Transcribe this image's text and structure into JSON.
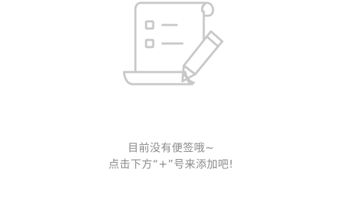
{
  "empty_state": {
    "icon": "notes-pencil-icon",
    "line1": "目前没有便签哦~",
    "line2": "点击下方“+”号来添加吧!"
  },
  "colors": {
    "background": "#ffffff",
    "icon_stroke": "#c8c8c8",
    "text": "#8a8a8a"
  }
}
